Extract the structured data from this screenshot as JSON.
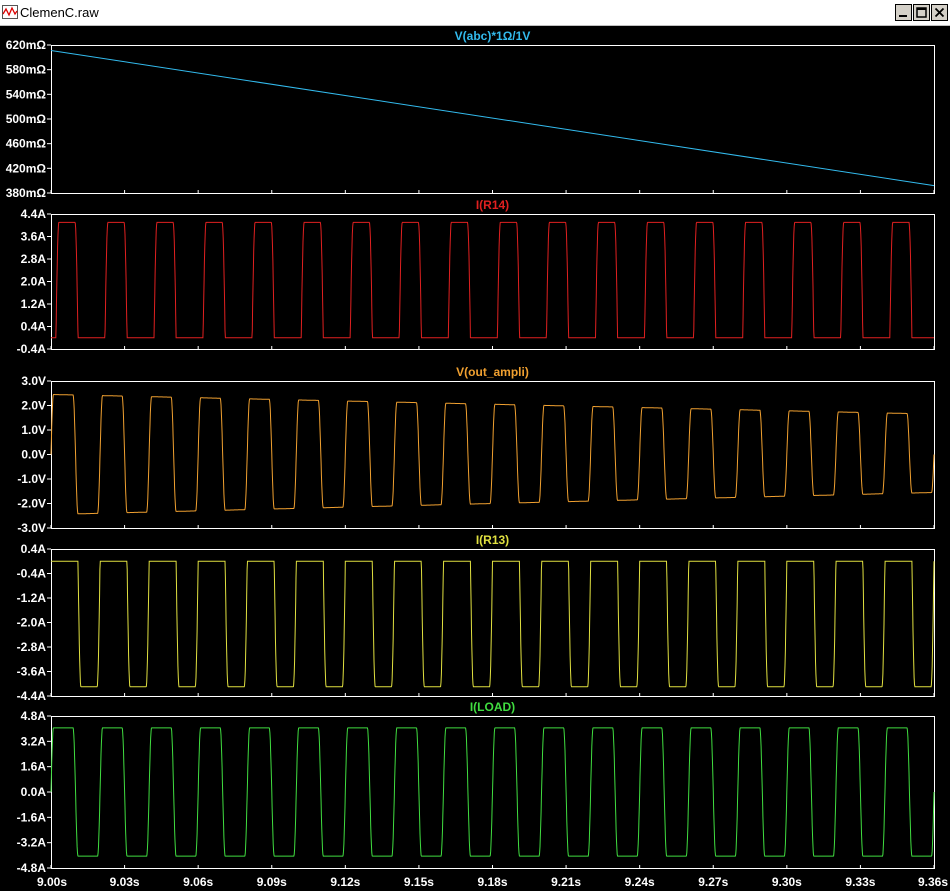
{
  "window": {
    "title": "ClemenC.raw",
    "minimize_label": "_",
    "restore_label": "❐",
    "close_label": "✕",
    "icon": "waveform-app-icon"
  },
  "chart_data": [
    {
      "type": "line",
      "title": "V(abc)*1Ω/1V",
      "color": "#33bbee",
      "yticks": [
        "620mΩ",
        "580mΩ",
        "540mΩ",
        "500mΩ",
        "460mΩ",
        "420mΩ",
        "380mΩ"
      ],
      "ylim": [
        380,
        620
      ],
      "waveform": "ramp",
      "series": [
        {
          "x": [
            9.0,
            9.36
          ],
          "y": [
            611,
            392
          ]
        }
      ]
    },
    {
      "type": "line",
      "title": "I(R14)",
      "color": "#e02020",
      "yticks": [
        "4.4A",
        "3.6A",
        "2.8A",
        "2.0A",
        "1.2A",
        "0.4A",
        "-0.4A"
      ],
      "ylim": [
        -0.4,
        4.4
      ],
      "waveform": "pulse_high",
      "params": {
        "high": 4.1,
        "low": 0.0,
        "period": 0.02,
        "phase": 0.002,
        "duty": 0.45,
        "droop": 0.0
      }
    },
    {
      "type": "line",
      "title": "V(out_ampli)",
      "color": "#f0a030",
      "yticks": [
        "3.0V",
        "2.0V",
        "1.0V",
        "0.0V",
        "-1.0V",
        "-2.0V",
        "-3.0V"
      ],
      "ylim": [
        -3.0,
        3.0
      ],
      "waveform": "square_bipolar",
      "params": {
        "high_start": 2.45,
        "high_end": 1.65,
        "low_start": -2.45,
        "low_end": -1.55,
        "period": 0.02,
        "phase": 0.0,
        "duty": 0.5
      }
    },
    {
      "type": "line",
      "title": "I(R13)",
      "color": "#e0e040",
      "yticks": [
        "0.4A",
        "-0.4A",
        "-1.2A",
        "-2.0A",
        "-2.8A",
        "-3.6A",
        "-4.4A"
      ],
      "ylim": [
        -4.4,
        0.4
      ],
      "waveform": "pulse_low",
      "params": {
        "high": 0.0,
        "low": -4.1,
        "period": 0.02,
        "phase": 0.011,
        "duty": 0.45
      }
    },
    {
      "type": "line",
      "title": "I(LOAD)",
      "color": "#40dd40",
      "yticks": [
        "4.8A",
        "3.2A",
        "1.6A",
        "0.0A",
        "-1.6A",
        "-3.2A",
        "-4.8A"
      ],
      "ylim": [
        -4.8,
        4.8
      ],
      "waveform": "square_bipolar",
      "params": {
        "high_start": 4.05,
        "high_end": 4.05,
        "low_start": -4.05,
        "low_end": -4.05,
        "period": 0.02,
        "phase": 0.0,
        "duty": 0.5
      }
    }
  ],
  "x_axis": {
    "xlim": [
      9.0,
      9.36
    ],
    "ticks": [
      "9.00s",
      "9.03s",
      "9.06s",
      "9.09s",
      "9.12s",
      "9.15s",
      "9.18s",
      "9.21s",
      "9.24s",
      "9.27s",
      "9.30s",
      "9.33s",
      "9.36s"
    ]
  },
  "colors": {
    "background": "#000000",
    "frame": "#ffffff",
    "axis_text": "#ffffff"
  }
}
